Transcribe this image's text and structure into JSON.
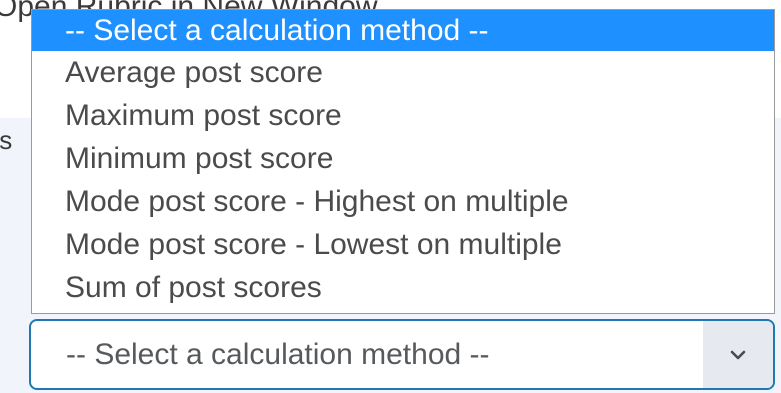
{
  "background": {
    "top_text": "Open Rubric in New Window",
    "side_text": "ts"
  },
  "dropdown": {
    "options": [
      "-- Select a calculation method --",
      "Average post score",
      "Maximum post score",
      "Minimum post score",
      "Mode post score - Highest on multiple",
      "Mode post score - Lowest on multiple",
      "Sum of post scores"
    ],
    "highlighted_index": 0,
    "selected_value": "-- Select a calculation method --",
    "arrow_icon": "chevron-down-icon"
  },
  "colors": {
    "highlight": "#1e90ff",
    "focus_border": "#1f78b4",
    "panel_background": "#f1f5fb"
  }
}
